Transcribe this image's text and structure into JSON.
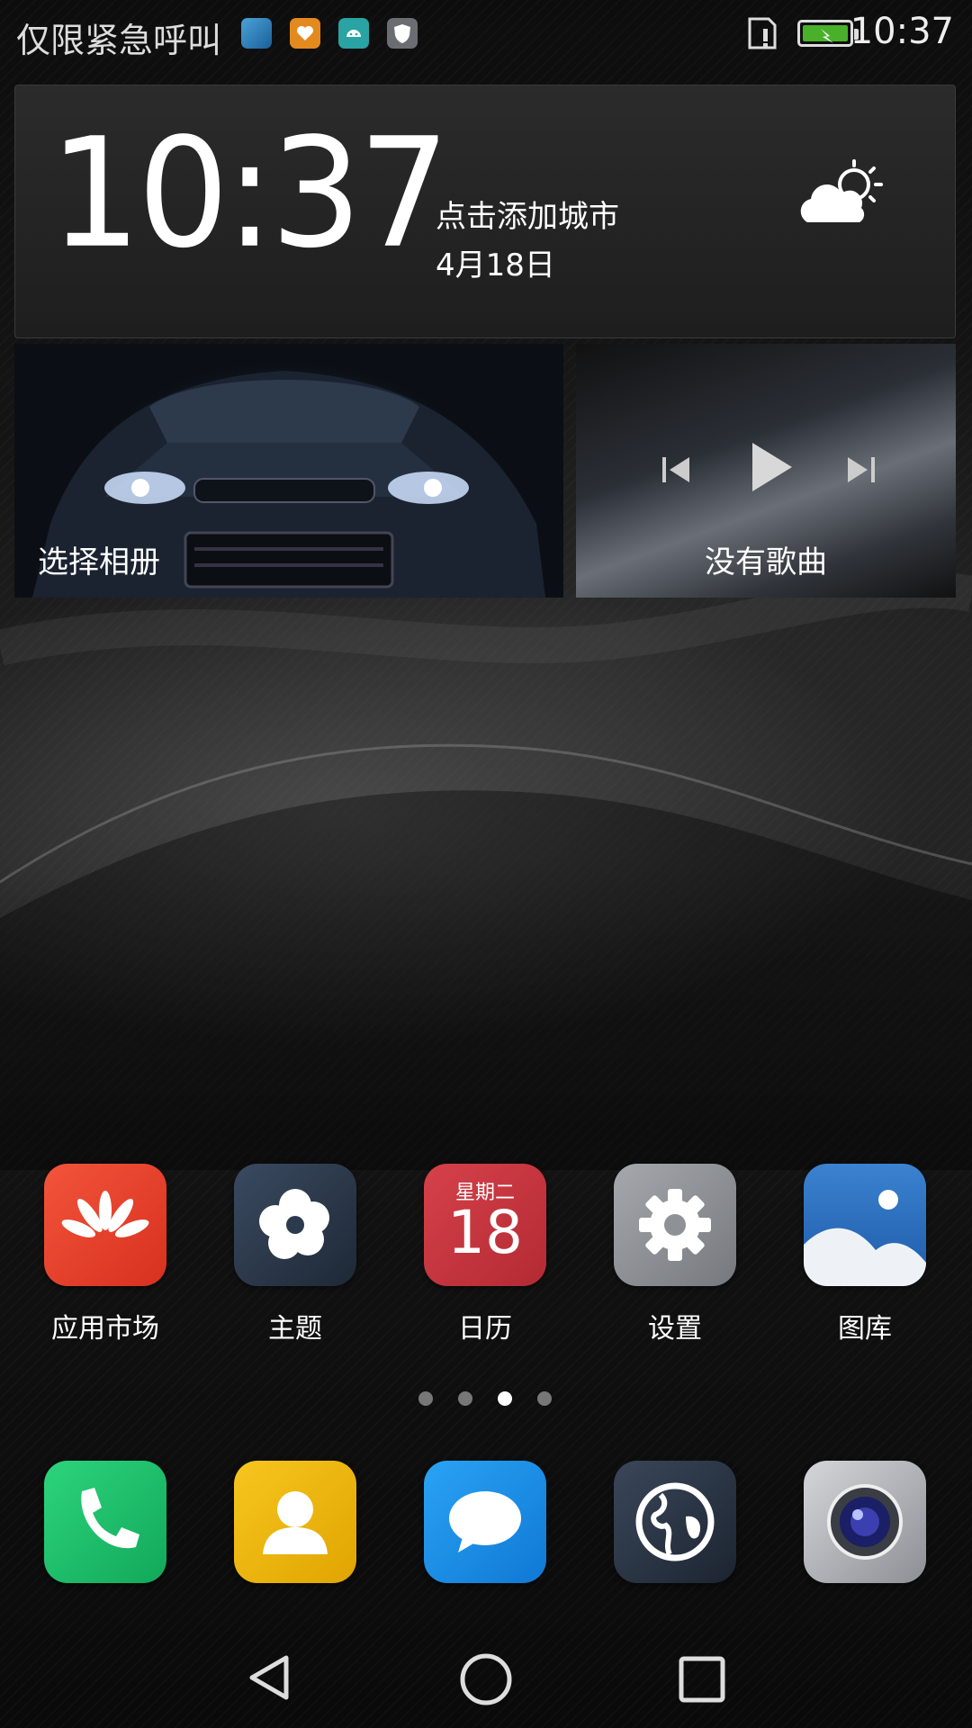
{
  "status_bar": {
    "carrier": "仅限紧急呼叫",
    "time": "10:37",
    "notification_icons": [
      "weather-app-icon",
      "health-app-icon",
      "android-icon",
      "shield-icon"
    ],
    "battery": "charging"
  },
  "clock_widget": {
    "time": "10:37",
    "city_prompt": "点击添加城市",
    "date": "4月18日",
    "weather_icon": "partly-cloudy-icon"
  },
  "album_widget": {
    "label": "选择相册"
  },
  "music_widget": {
    "label": "没有歌曲"
  },
  "apps": [
    {
      "name": "应用市场",
      "icon": "huawei-appgallery-icon",
      "color": "#e8412a"
    },
    {
      "name": "主题",
      "icon": "themes-icon",
      "color": "#2c3a4e"
    },
    {
      "name": "日历",
      "icon": "calendar-icon",
      "color": "#c5353d",
      "weekday": "星期二",
      "day": "18"
    },
    {
      "name": "设置",
      "icon": "settings-gear-icon",
      "color": "#8e9196"
    },
    {
      "name": "图库",
      "icon": "gallery-icon",
      "color": "#2a6fbf"
    }
  ],
  "page_indicator": {
    "count": 4,
    "active_page": 3
  },
  "dock": [
    {
      "icon": "phone-icon",
      "color": "#1fbf6a"
    },
    {
      "icon": "contacts-icon",
      "color": "#f2b90d"
    },
    {
      "icon": "messages-icon",
      "color": "#1a8fe6"
    },
    {
      "icon": "browser-icon",
      "color": "#2b3646"
    },
    {
      "icon": "camera-icon",
      "color": "#b5b8bd"
    }
  ],
  "nav_bar": [
    "back-icon",
    "home-icon",
    "recents-icon"
  ]
}
